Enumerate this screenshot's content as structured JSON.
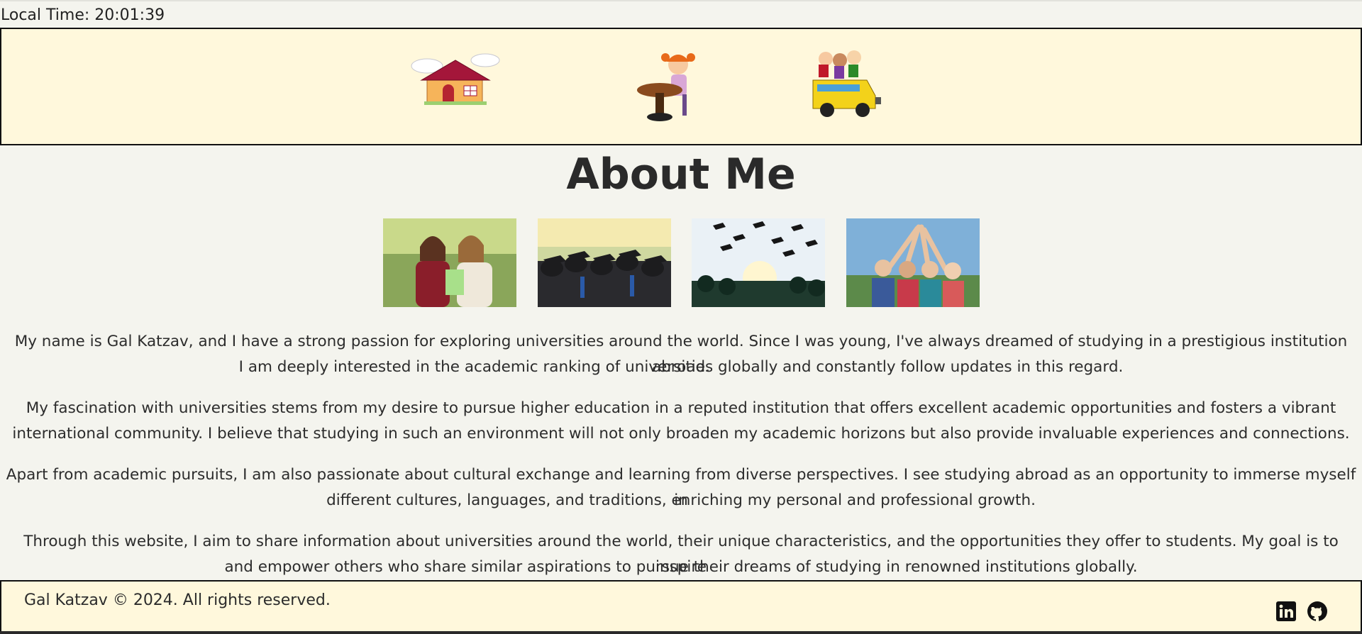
{
  "local_time": "Local Time: 20:01:39",
  "header": {
    "icons": [
      "house-icon",
      "student-desk-icon",
      "school-bus-icon"
    ]
  },
  "title": "About Me",
  "photos": [
    "students-talking-photo",
    "graduates-back-photo",
    "caps-toss-photo",
    "friends-high-five-photo"
  ],
  "paragraphs": {
    "p1_line1": "My name is Gal Katzav, and I have a strong passion for exploring universities around the world. Since I was young, I've always dreamed of studying in a prestigious institution abroad.",
    "p1_line2": "I am deeply interested in the academic ranking of universities globally and constantly follow updates in this regard.",
    "p2_line1": "My fascination with universities stems from my desire to pursue higher education in a reputed institution that offers excellent academic opportunities and fosters a vibrant",
    "p2_line2": "international community. I believe that studying in such an environment will not only broaden my academic horizons but also provide invaluable experiences and connections.",
    "p3_line1": "Apart from academic pursuits, I am also passionate about cultural exchange and learning from diverse perspectives. I see studying abroad as an opportunity to immerse myself in",
    "p3_line2": "different cultures, languages, and traditions, enriching my personal and professional growth.",
    "p4_line1": "Through this website, I aim to share information about universities around the world, their unique characteristics, and the opportunities they offer to students. My goal is to inspire",
    "p4_line2": "and empower others who share similar aspirations to pursue their dreams of studying in renowned institutions globally."
  },
  "footer": {
    "copyright": "Gal Katzav © 2024. All rights reserved.",
    "social_icons": [
      "linkedin-icon",
      "github-icon"
    ]
  },
  "colors": {
    "page_bg": "#f4f4ee",
    "header_bg": "#fff8dc",
    "border": "#111111"
  }
}
